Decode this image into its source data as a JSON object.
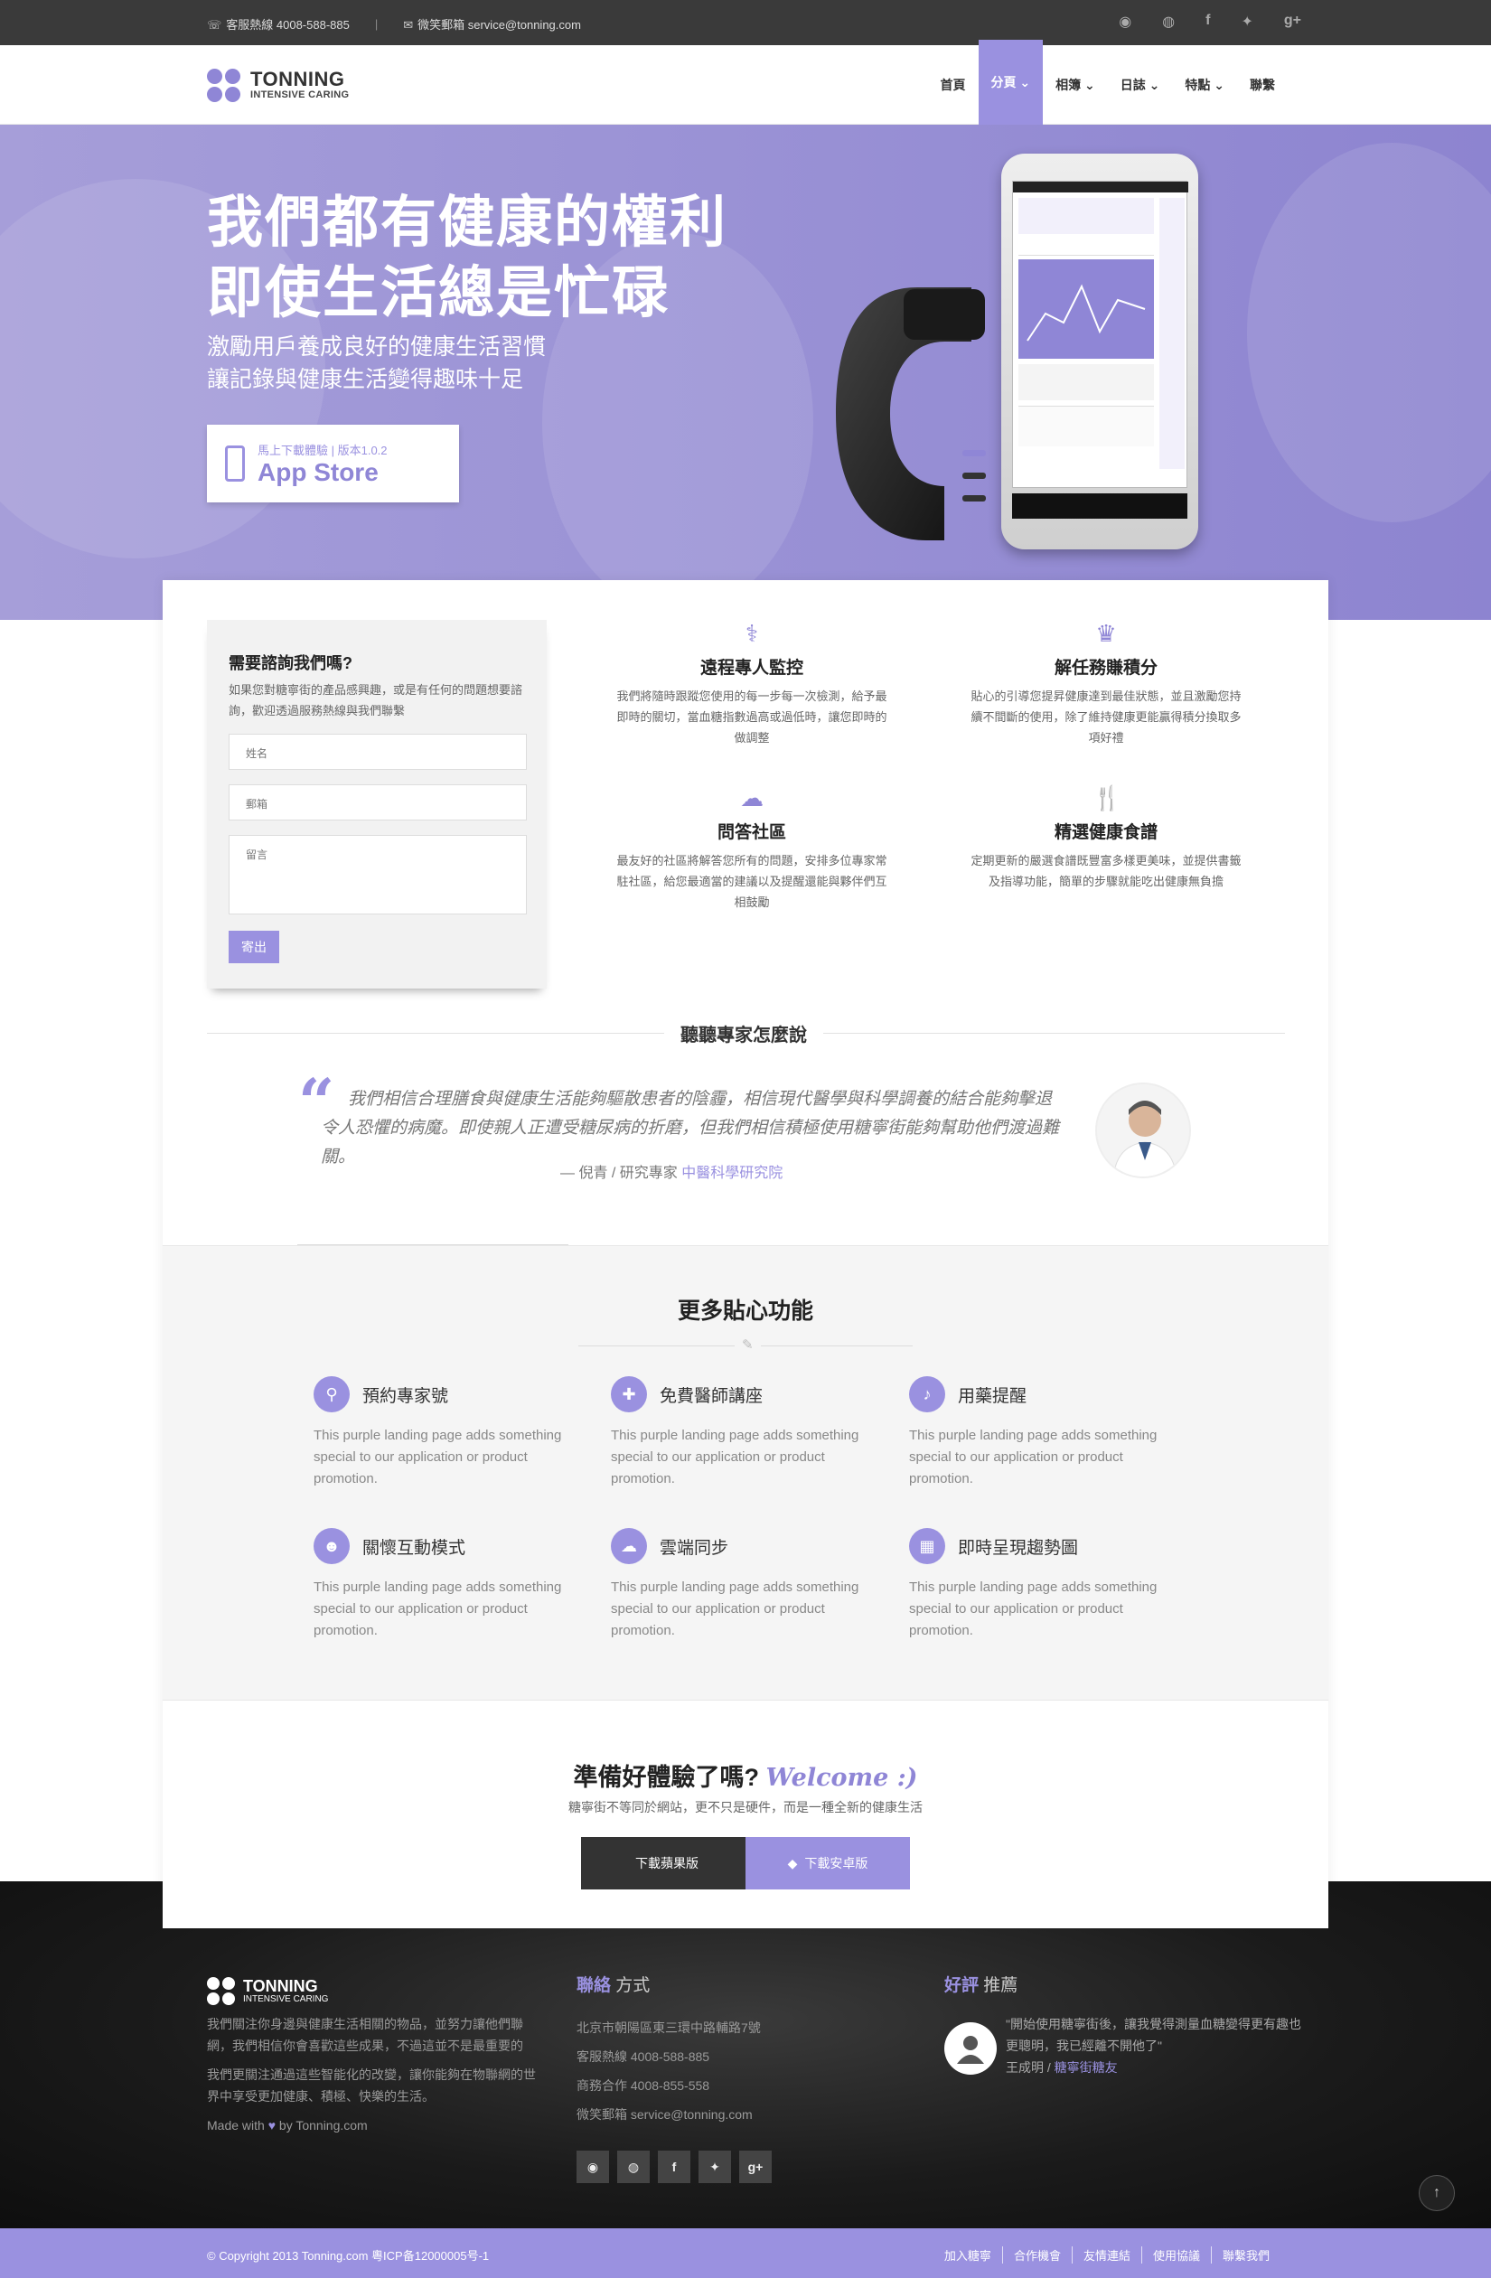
{
  "topbar": {
    "hotline": "客服熱線 4008-588-885",
    "email": "微笑郵箱 service@tonning.com",
    "social": [
      "weibo",
      "renren",
      "f",
      "twitter",
      "g+"
    ]
  },
  "logo": {
    "name": "TONNING",
    "tagline": "INTENSIVE CARING"
  },
  "nav": [
    "首頁",
    "分頁",
    "相簿",
    "日誌",
    "特點",
    "聯繫"
  ],
  "hero": {
    "title1": "我們都有健康的權利",
    "title2": "即使生活總是忙碌",
    "sub1": "激勵用戶養成良好的健康生活習慣",
    "sub2": "讓記錄與健康生活變得趣味十足",
    "app_line1": "馬上下載體驗 | 版本1.0.2",
    "app_line2": "App Store"
  },
  "form": {
    "title": "需要諮詢我們嗎?",
    "desc": "如果您對糖寧街的產品感興趣，或是有任何的問題想要諮詢，歡迎透過服務熱線與我們聯繫",
    "name_ph": "姓名",
    "email_ph": "郵箱",
    "msg_ph": "留言",
    "submit": "寄出"
  },
  "features": [
    {
      "title": "遠程專人監控",
      "text": "我們將隨時跟蹤您使用的每一步每一次檢測，給予最即時的關切，當血糖指數過高或過低時，讓您即時的做調整"
    },
    {
      "title": "解任務賺積分",
      "text": "貼心的引導您提昇健康達到最佳狀態，並且激勵您持續不間斷的使用，除了維持健康更能贏得積分換取多項好禮"
    },
    {
      "title": "問答社區",
      "text": "最友好的社區將解答您所有的問題，安排多位專家常駐社區，給您最適當的建議以及提醒還能與夥伴們互相鼓勵"
    },
    {
      "title": "精選健康食譜",
      "text": "定期更新的嚴選食譜既豐富多樣更美味，並提供書籤及指導功能，簡單的步驟就能吃出健康無負擔"
    }
  ],
  "expert": {
    "heading": "聽聽專家怎麼說",
    "quote": "我們相信合理膳食與健康生活能夠驅散患者的陰霾，相信現代醫學與科學調養的結合能夠擊退令人恐懼的病魔。即使親人正遭受糖尿病的折磨，但我們相信積極使用糖寧街能夠幫助他們渡過難關。",
    "by": "— 倪青 / 研究專家",
    "org": "中醫科學研究院"
  },
  "more": {
    "heading": "更多貼心功能",
    "items": [
      {
        "title": "預約專家號",
        "text": "This purple landing page adds something special to our application or product promotion."
      },
      {
        "title": "免費醫師講座",
        "text": "This purple landing page adds something special to our application or product promotion."
      },
      {
        "title": "用藥提醒",
        "text": "This purple landing page adds something special to our application or product promotion."
      },
      {
        "title": "關懷互動模式",
        "text": "This purple landing page adds something special to our application or product promotion."
      },
      {
        "title": "雲端同步",
        "text": "This purple landing page adds something special to our application or product promotion."
      },
      {
        "title": "即時呈現趨勢圖",
        "text": "This purple landing page adds something special to our application or product promotion."
      }
    ]
  },
  "cta": {
    "title": "準備好體驗了嗎?",
    "welcome": "Welcome :)",
    "sub": "糖寧街不等同於網站，更不只是硬件，而是一種全新的健康生活",
    "btn_ios": "下載蘋果版",
    "btn_android": "下載安卓版"
  },
  "footer": {
    "about1": "我們關注你身邊與健康生活相關的物品，並努力讓他們聯網，我們相信你會喜歡這些成果，不過這並不是最重要的",
    "about2": "我們更關注通過這些智能化的改變，讓你能夠在物聯網的世界中享受更加健康、積極、快樂的生活。",
    "made_pre": "Made with",
    "made_post": "by Tonning.com",
    "contact_h_a": "聯絡",
    "contact_h_b": "方式",
    "address": "北京市朝陽區東三環中路輔路7號",
    "hotline": "客服熱線 4008-588-885",
    "biz": "商務合作 4008-855-558",
    "email": "微笑郵箱 service@tonning.com",
    "review_h_a": "好評",
    "review_h_b": "推薦",
    "review": "\"開始使用糖寧街後，讓我覺得測量血糖變得更有趣也更聰明，我已經離不開他了\"",
    "reviewer": "王成明 /",
    "reviewer_tag": "糖寧街糖友"
  },
  "bottom": {
    "copy": "© Copyright 2013 Tonning.com 粵ICP备12000005号-1",
    "links": [
      "加入糖寧",
      "合作機會",
      "友情連結",
      "使用協議",
      "聯繫我們"
    ]
  },
  "colors": {
    "accent": "#9a91e0",
    "dark": "#3a3a3a"
  }
}
